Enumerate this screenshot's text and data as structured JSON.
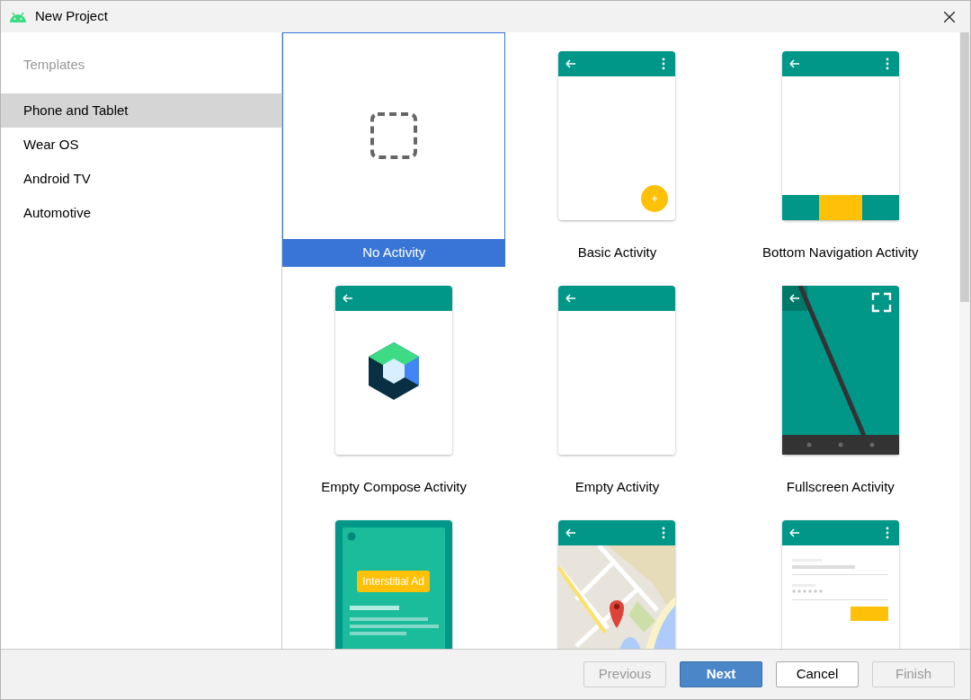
{
  "window": {
    "title": "New Project"
  },
  "sidebar": {
    "heading": "Templates",
    "items": [
      {
        "label": "Phone and Tablet",
        "selected": true
      },
      {
        "label": "Wear OS",
        "selected": false
      },
      {
        "label": "Android TV",
        "selected": false
      },
      {
        "label": "Automotive",
        "selected": false
      }
    ]
  },
  "templates": [
    {
      "kind": "none",
      "label": "No Activity",
      "selected": true
    },
    {
      "kind": "basic",
      "label": "Basic Activity",
      "selected": false
    },
    {
      "kind": "bottom_nav",
      "label": "Bottom Navigation Activity",
      "selected": false
    },
    {
      "kind": "compose",
      "label": "Empty Compose Activity",
      "selected": false
    },
    {
      "kind": "empty",
      "label": "Empty Activity",
      "selected": false
    },
    {
      "kind": "fullscreen",
      "label": "Fullscreen Activity",
      "selected": false
    },
    {
      "kind": "ad",
      "ad_text": "Interstitial Ad",
      "selected": false
    },
    {
      "kind": "maps",
      "selected": false
    },
    {
      "kind": "login",
      "selected": false
    }
  ],
  "buttons": [
    {
      "label": "Previous",
      "kind": "default",
      "disabled": true
    },
    {
      "label": "Next",
      "kind": "primary",
      "disabled": false
    },
    {
      "label": "Cancel",
      "kind": "default",
      "disabled": false
    },
    {
      "label": "Finish",
      "kind": "default",
      "disabled": true
    }
  ]
}
